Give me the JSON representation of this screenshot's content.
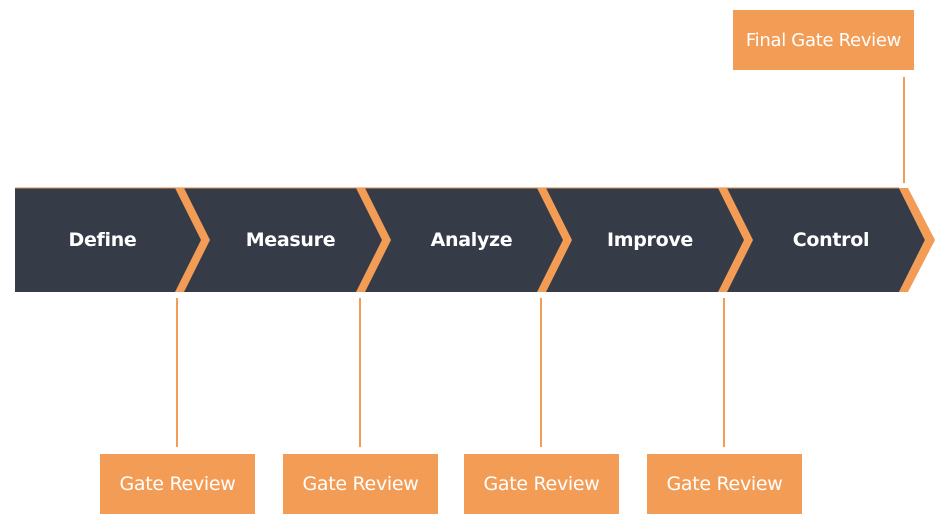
{
  "colors": {
    "band": "#363b48",
    "accent": "#f39c55",
    "text": "#ffffff"
  },
  "stages": [
    {
      "label": "Define"
    },
    {
      "label": "Measure"
    },
    {
      "label": "Analyze"
    },
    {
      "label": "Improve"
    },
    {
      "label": "Control"
    }
  ],
  "gate_reviews": [
    {
      "label": "Gate Review"
    },
    {
      "label": "Gate Review"
    },
    {
      "label": "Gate Review"
    },
    {
      "label": "Gate Review"
    }
  ],
  "final_gate": {
    "label": "Final Gate Review"
  }
}
